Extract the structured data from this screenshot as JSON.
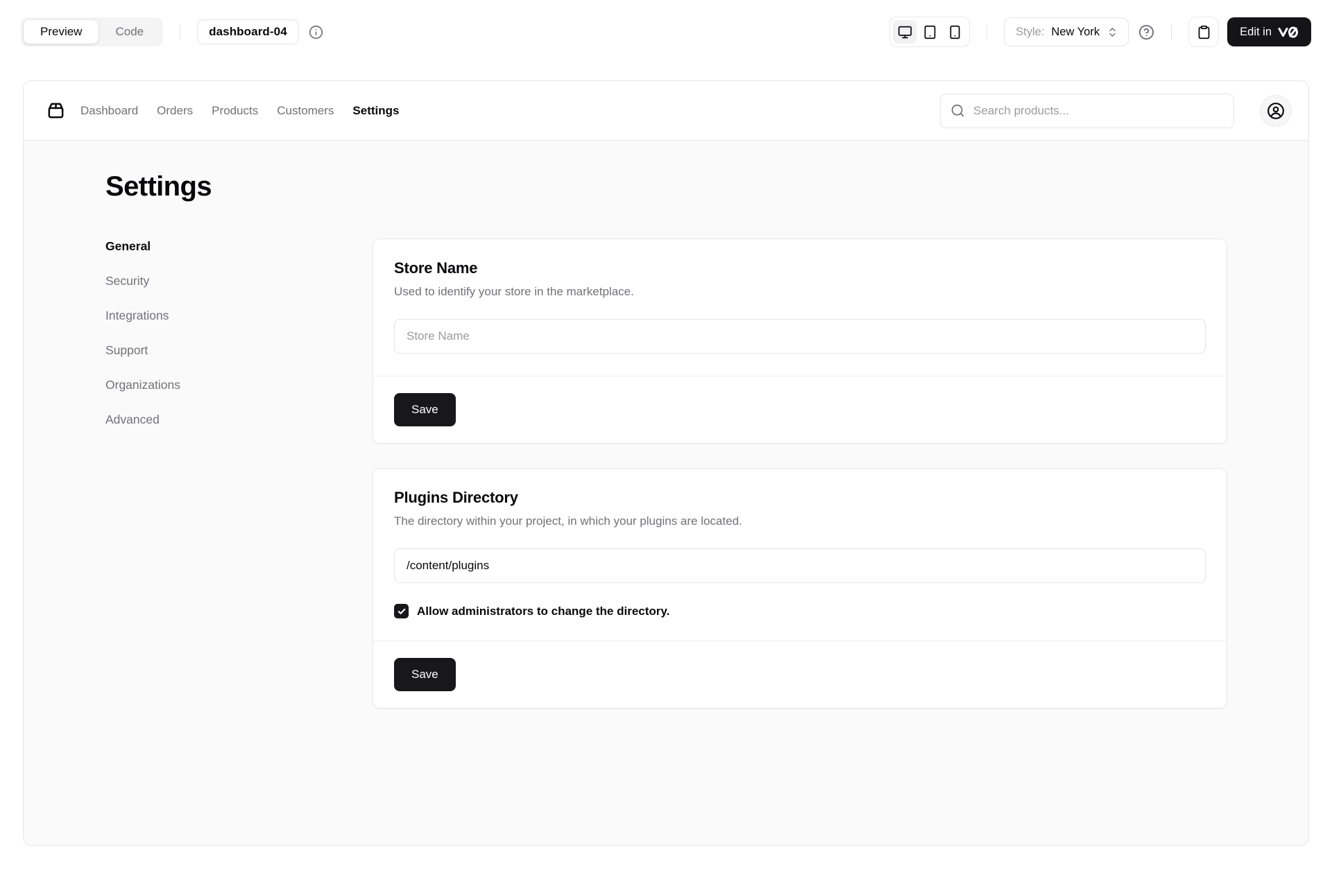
{
  "toolbar": {
    "view_toggle": {
      "preview_label": "Preview",
      "code_label": "Code"
    },
    "block_name": "dashboard-04",
    "style_label": "Style:",
    "style_value": "New York",
    "edit_button_label": "Edit in"
  },
  "app": {
    "nav": {
      "items": [
        {
          "label": "Dashboard",
          "active": false
        },
        {
          "label": "Orders",
          "active": false
        },
        {
          "label": "Products",
          "active": false
        },
        {
          "label": "Customers",
          "active": false
        },
        {
          "label": "Settings",
          "active": true
        }
      ],
      "search_placeholder": "Search products..."
    },
    "page": {
      "title": "Settings",
      "sidebar": [
        {
          "label": "General",
          "active": true
        },
        {
          "label": "Security",
          "active": false
        },
        {
          "label": "Integrations",
          "active": false
        },
        {
          "label": "Support",
          "active": false
        },
        {
          "label": "Organizations",
          "active": false
        },
        {
          "label": "Advanced",
          "active": false
        }
      ],
      "cards": [
        {
          "title": "Store Name",
          "description": "Used to identify your store in the marketplace.",
          "input_placeholder": "Store Name",
          "input_value": "",
          "save_label": "Save"
        },
        {
          "title": "Plugins Directory",
          "description": "The directory within your project, in which your plugins are located.",
          "input_value": "/content/plugins",
          "checkbox_label": "Allow administrators to change the directory.",
          "checkbox_checked": true,
          "save_label": "Save"
        }
      ]
    }
  },
  "colors": {
    "accent_dark": "#18181b",
    "muted_text": "#71717a",
    "border": "#e4e4e7",
    "muted_bg": "#f4f4f5",
    "content_bg": "#fafafa"
  }
}
